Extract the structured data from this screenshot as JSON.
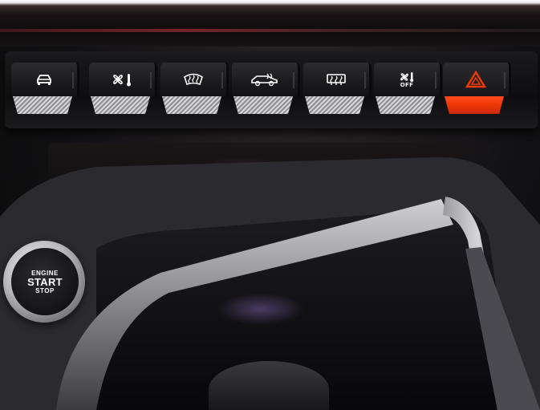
{
  "controls": [
    {
      "name": "drive-mode",
      "icon": "car-outline-icon"
    },
    {
      "name": "fan-climate",
      "icon": "fan-thermometer-icon"
    },
    {
      "name": "front-defrost",
      "icon": "windshield-defrost-icon"
    },
    {
      "name": "eco-drive",
      "icon": "car-eco-icon"
    },
    {
      "name": "rear-defrost",
      "icon": "rear-window-defrost-icon"
    },
    {
      "name": "climate-off",
      "icon": "fan-off-icon",
      "label": "OFF"
    },
    {
      "name": "hazard",
      "icon": "hazard-triangle-icon",
      "accent": "#f03a0a"
    }
  ],
  "start_button": {
    "line1": "ENGINE",
    "line2": "START",
    "line3": "STOP"
  },
  "colors": {
    "chrome": "#c9c9cc",
    "hazard": "#f03a0a",
    "panel": "#121113"
  }
}
